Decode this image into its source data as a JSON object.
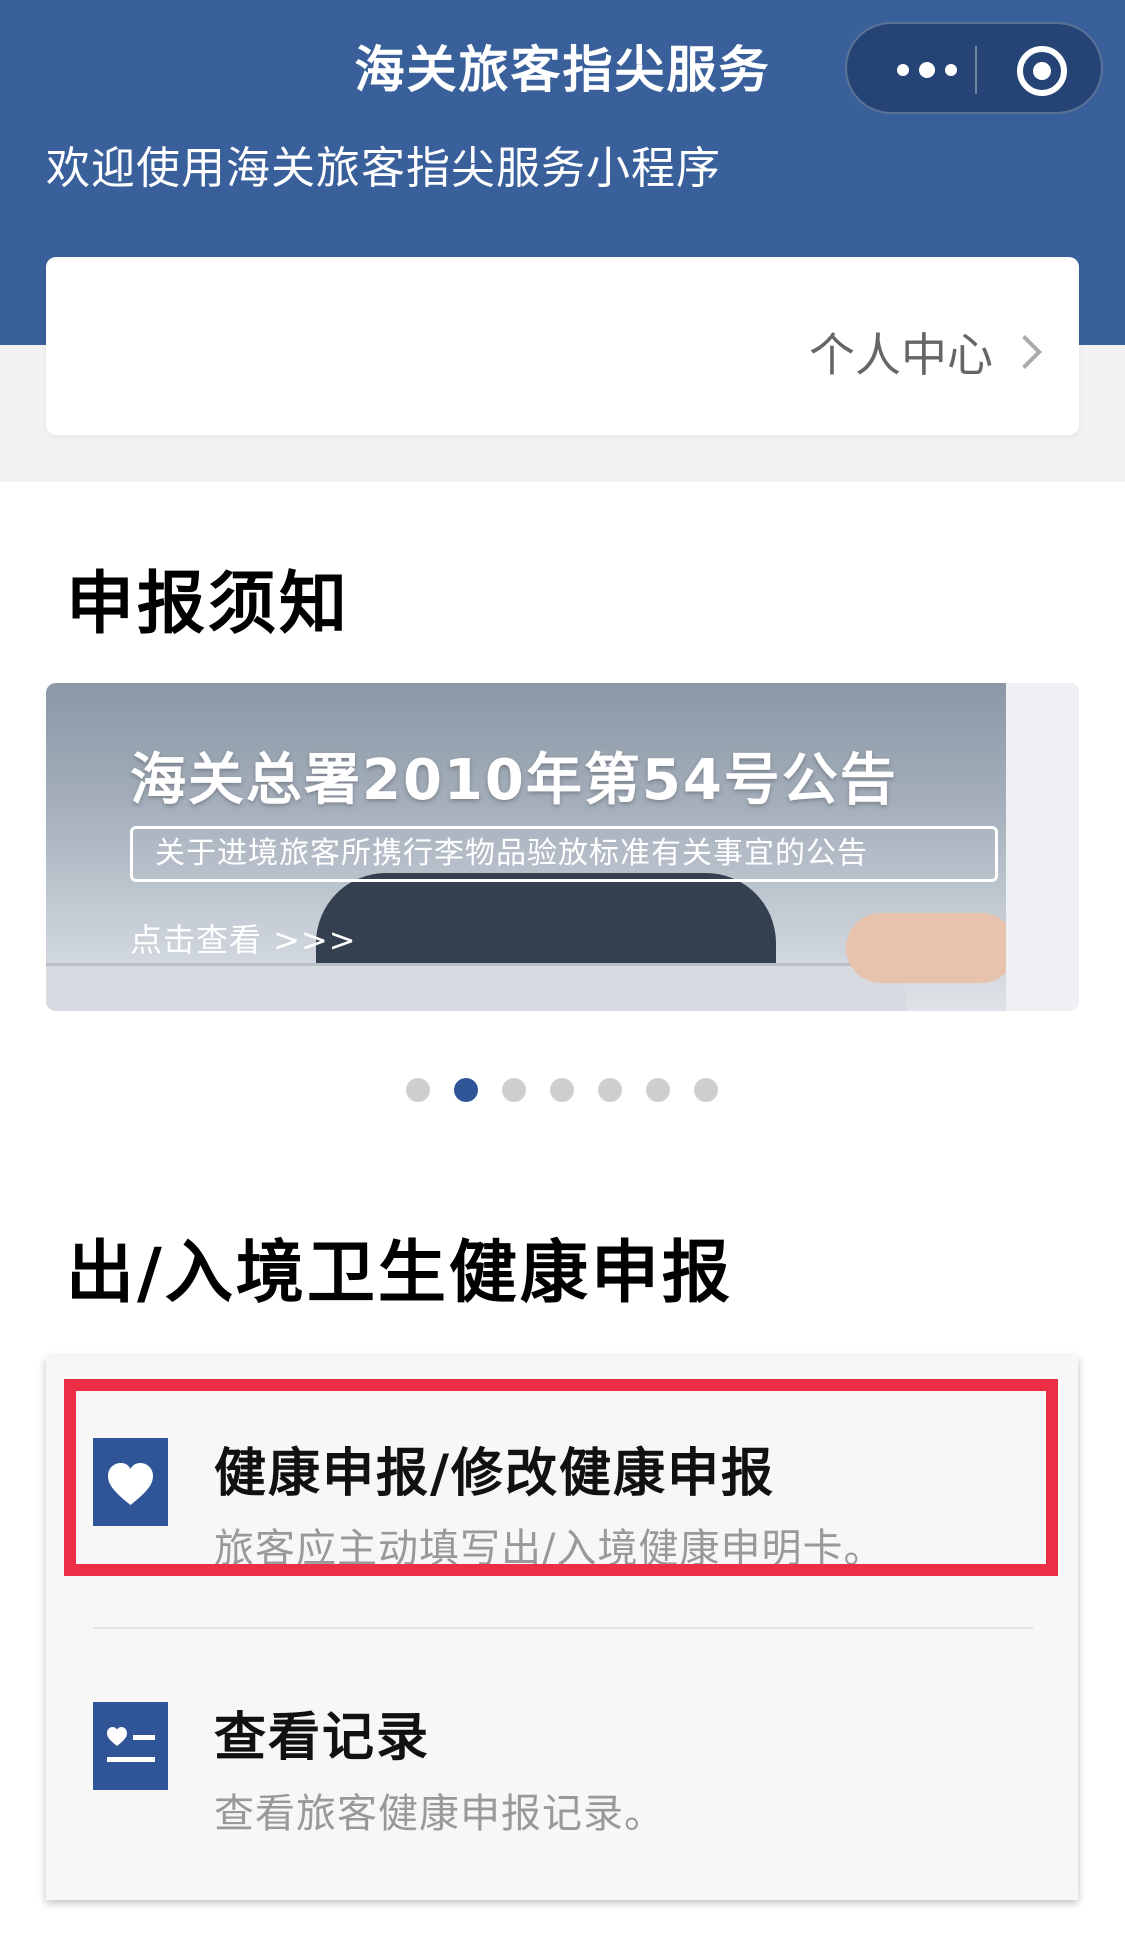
{
  "nav": {
    "title": "海关旅客指尖服务",
    "more_icon": "more-dots-icon",
    "close_icon": "close-ring-icon"
  },
  "header": {
    "welcome": "欢迎使用海关旅客指尖服务小程序",
    "personal_center": "个人中心"
  },
  "notice": {
    "section_title": "申报须知",
    "banner": {
      "title": "海关总署2010年第54号公告",
      "subtitle": "关于进境旅客所携行李物品验放标准有关事宜的公告",
      "cta": "点击查看 >>>"
    },
    "pager": {
      "total": 7,
      "active_index": 1
    }
  },
  "health": {
    "section_title": "出/入境卫生健康申报",
    "items": [
      {
        "icon": "heart-icon",
        "title": "健康申报/修改健康申报",
        "subtitle": "旅客应主动填写出/入境健康申明卡。"
      },
      {
        "icon": "checklist-icon",
        "title": "查看记录",
        "subtitle": "查看旅客健康申报记录。"
      }
    ]
  },
  "colors": {
    "brand_blue": "#3a609b",
    "accent_blue": "#2f5597",
    "highlight_red": "#ec2f45",
    "page_grey": "#f2f2f2"
  }
}
